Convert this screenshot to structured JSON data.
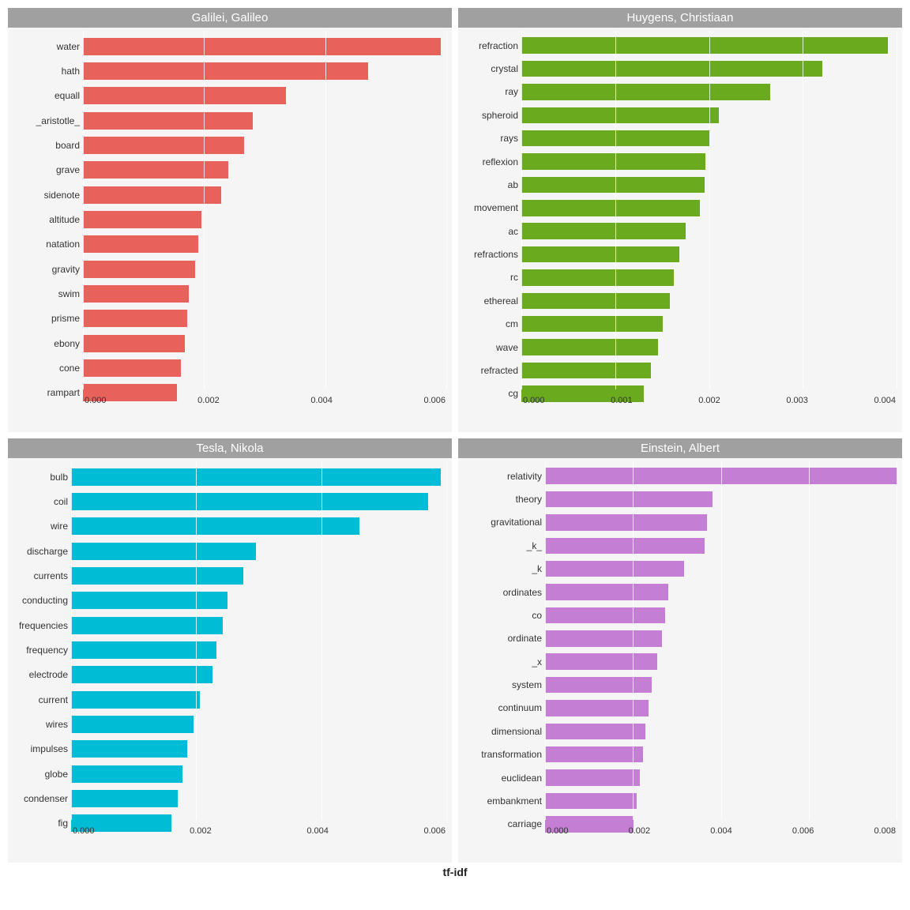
{
  "title": "tf-idf",
  "panels": [
    {
      "id": "galileo",
      "title": "Galilei, Galileo",
      "color": "#e8615a",
      "xmax": 0.006,
      "xticks": [
        "0.000",
        "0.002",
        "0.004",
        "0.006"
      ],
      "items": [
        {
          "label": "water",
          "value": 0.0059
        },
        {
          "label": "hath",
          "value": 0.0047
        },
        {
          "label": "equall",
          "value": 0.00335
        },
        {
          "label": "_aristotle_",
          "value": 0.0028
        },
        {
          "label": "board",
          "value": 0.00265
        },
        {
          "label": "grave",
          "value": 0.0024
        },
        {
          "label": "sidenote",
          "value": 0.00228
        },
        {
          "label": "altitude",
          "value": 0.00195
        },
        {
          "label": "natation",
          "value": 0.0019
        },
        {
          "label": "gravity",
          "value": 0.00185
        },
        {
          "label": "swim",
          "value": 0.00175
        },
        {
          "label": "prisme",
          "value": 0.00172
        },
        {
          "label": "ebony",
          "value": 0.00168
        },
        {
          "label": "cone",
          "value": 0.00162
        },
        {
          "label": "rampart",
          "value": 0.00155
        }
      ]
    },
    {
      "id": "huygens",
      "title": "Huygens, Christiaan",
      "color": "#6aaa1e",
      "xmax": 0.004,
      "xticks": [
        "0.000",
        "0.001",
        "0.002",
        "0.003",
        "0.004"
      ],
      "items": [
        {
          "label": "refraction",
          "value": 0.0039
        },
        {
          "label": "crystal",
          "value": 0.0032
        },
        {
          "label": "ray",
          "value": 0.00265
        },
        {
          "label": "spheroid",
          "value": 0.0021
        },
        {
          "label": "rays",
          "value": 0.002
        },
        {
          "label": "reflexion",
          "value": 0.00196
        },
        {
          "label": "ab",
          "value": 0.00195
        },
        {
          "label": "movement",
          "value": 0.0019
        },
        {
          "label": "ac",
          "value": 0.00175
        },
        {
          "label": "refractions",
          "value": 0.00168
        },
        {
          "label": "rc",
          "value": 0.00162
        },
        {
          "label": "ethereal",
          "value": 0.00158
        },
        {
          "label": "cm",
          "value": 0.0015
        },
        {
          "label": "wave",
          "value": 0.00145
        },
        {
          "label": "refracted",
          "value": 0.00138
        },
        {
          "label": "cg",
          "value": 0.0013
        }
      ]
    },
    {
      "id": "tesla",
      "title": "Tesla, Nikola",
      "color": "#00bcd4",
      "xmax": 0.006,
      "xticks": [
        "0.000",
        "0.002",
        "0.004",
        "0.006"
      ],
      "items": [
        {
          "label": "bulb",
          "value": 0.0059
        },
        {
          "label": "coil",
          "value": 0.0057
        },
        {
          "label": "wire",
          "value": 0.0046
        },
        {
          "label": "discharge",
          "value": 0.00295
        },
        {
          "label": "currents",
          "value": 0.00275
        },
        {
          "label": "conducting",
          "value": 0.0025
        },
        {
          "label": "frequencies",
          "value": 0.00242
        },
        {
          "label": "frequency",
          "value": 0.00232
        },
        {
          "label": "electrode",
          "value": 0.00225
        },
        {
          "label": "current",
          "value": 0.00205
        },
        {
          "label": "wires",
          "value": 0.00195
        },
        {
          "label": "impulses",
          "value": 0.00185
        },
        {
          "label": "globe",
          "value": 0.00178
        },
        {
          "label": "condenser",
          "value": 0.0017
        },
        {
          "label": "fig",
          "value": 0.0016
        }
      ]
    },
    {
      "id": "einstein",
      "title": "Einstein, Albert",
      "color": "#c47ed4",
      "xmax": 0.008,
      "xticks": [
        "0.000",
        "0.002",
        "0.004",
        "0.006",
        "0.008"
      ],
      "items": [
        {
          "label": "relativity",
          "value": 0.0084
        },
        {
          "label": "theory",
          "value": 0.0038
        },
        {
          "label": "gravitational",
          "value": 0.00368
        },
        {
          "label": "_k_",
          "value": 0.00362
        },
        {
          "label": "_k",
          "value": 0.00315
        },
        {
          "label": "ordinates",
          "value": 0.0028
        },
        {
          "label": "co",
          "value": 0.00272
        },
        {
          "label": "ordinate",
          "value": 0.00265
        },
        {
          "label": "_x",
          "value": 0.00255
        },
        {
          "label": "system",
          "value": 0.00242
        },
        {
          "label": "continuum",
          "value": 0.00235
        },
        {
          "label": "dimensional",
          "value": 0.00228
        },
        {
          "label": "transformation",
          "value": 0.00222
        },
        {
          "label": "euclidean",
          "value": 0.00215
        },
        {
          "label": "embankment",
          "value": 0.00208
        },
        {
          "label": "carriage",
          "value": 0.002
        }
      ]
    }
  ]
}
